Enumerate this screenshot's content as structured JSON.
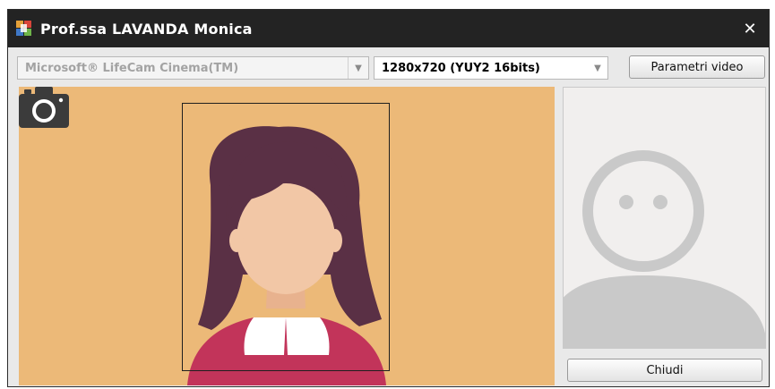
{
  "window": {
    "title": "Prof.ssa LAVANDA Monica",
    "icon": "app-logo-icon",
    "close_label": "✕"
  },
  "toolbar": {
    "camera_select": {
      "value": "Microsoft® LifeCam Cinema(TM)",
      "enabled": false
    },
    "resolution_select": {
      "value": "1280x720 (YUY2 16bits)",
      "enabled": true
    },
    "video_params_label": "Parametri video"
  },
  "preview": {
    "background_color": "#ecb978",
    "capture_icon": "camera-icon"
  },
  "thumbnail": {
    "placeholder_icon": "person-placeholder-icon"
  },
  "footer": {
    "close_label": "Chiudi"
  }
}
